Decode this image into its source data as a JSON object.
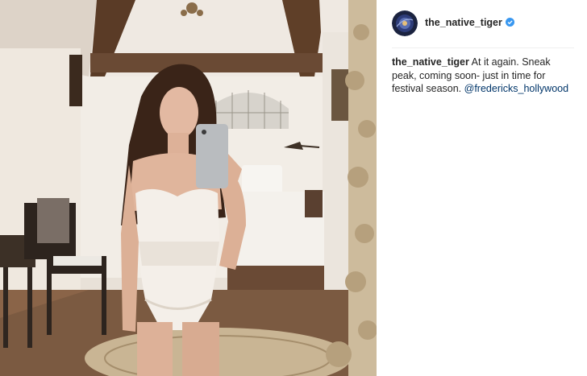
{
  "post": {
    "username": "the_native_tiger",
    "verified_icon": "verified-badge-icon",
    "caption": {
      "author": "the_native_tiger",
      "text": " At it again. Sneak peak, coming soon- just in time for festival season. ",
      "mention": "@fredericks_hollywood"
    },
    "image_alt": "Mirror selfie in white lace bodysuit",
    "colors": {
      "verified": "#3897f0",
      "mention": "#003569",
      "text": "#262626"
    }
  }
}
